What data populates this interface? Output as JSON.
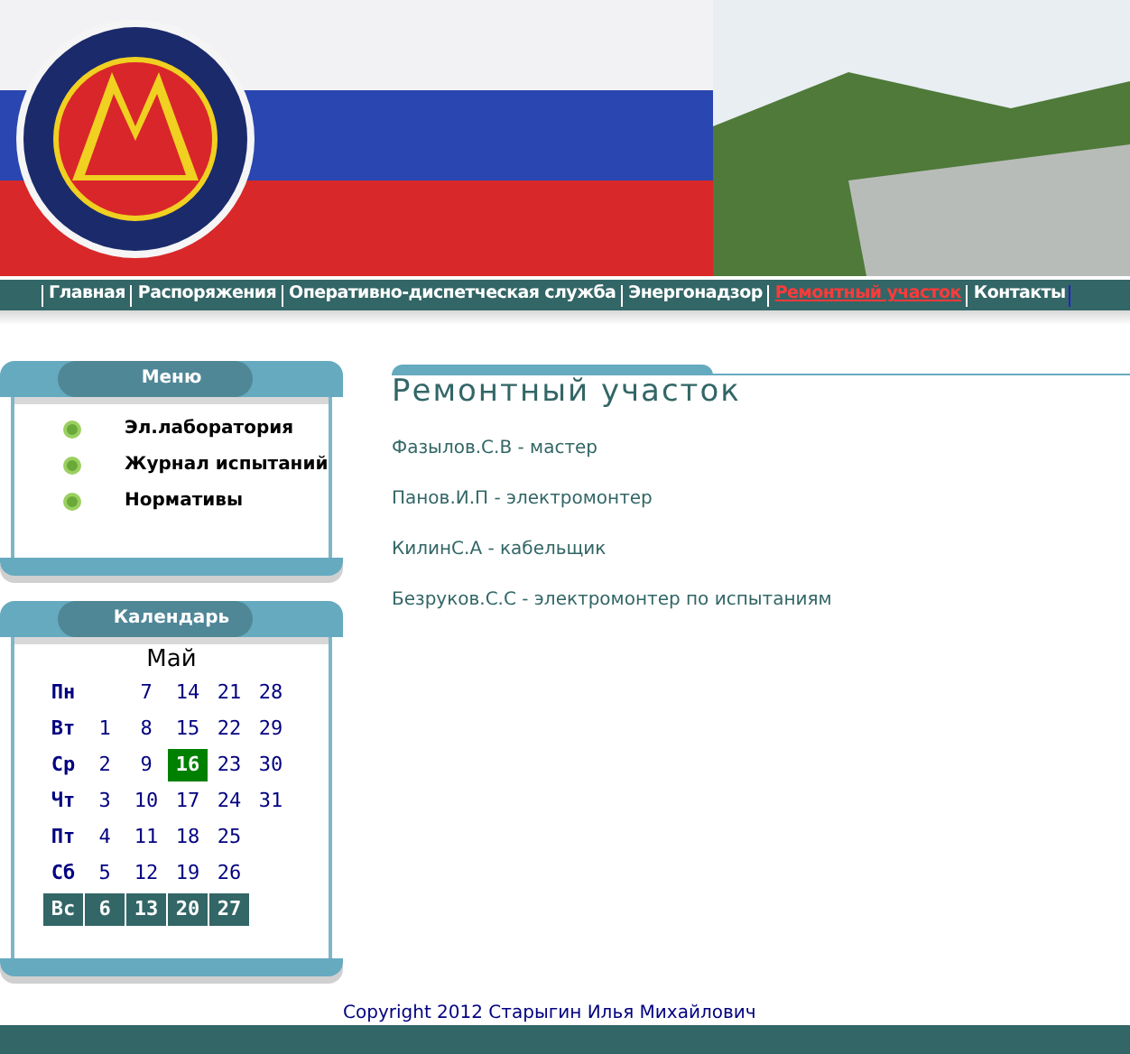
{
  "nav": [
    {
      "label": "Главная",
      "selected": false
    },
    {
      "label": "Распоряжения",
      "selected": false
    },
    {
      "label": "Оперативно-диспетческая служба",
      "selected": false
    },
    {
      "label": "Энергонадзор",
      "selected": false
    },
    {
      "label": "Ремонтный участок",
      "selected": true
    },
    {
      "label": "Контакты",
      "selected": false
    }
  ],
  "menu": {
    "title": "Меню",
    "items": [
      "Эл.лаборатория",
      "Журнал испытаний",
      "Нормативы"
    ]
  },
  "calendar": {
    "title": "Календарь",
    "month": "Май",
    "rows": [
      {
        "day": "Пн",
        "weekend": false,
        "cells": [
          null,
          {
            "text": "7",
            "selected": false
          },
          {
            "text": "14",
            "selected": false
          },
          {
            "text": "21",
            "selected": false
          },
          {
            "text": "28",
            "selected": false
          }
        ]
      },
      {
        "day": "Вт",
        "weekend": false,
        "cells": [
          {
            "text": "1",
            "selected": false
          },
          {
            "text": "8",
            "selected": false
          },
          {
            "text": "15",
            "selected": false
          },
          {
            "text": "22",
            "selected": false
          },
          {
            "text": "29",
            "selected": false
          }
        ]
      },
      {
        "day": "Ср",
        "weekend": false,
        "cells": [
          {
            "text": "2",
            "selected": false
          },
          {
            "text": "9",
            "selected": false
          },
          {
            "text": "16",
            "selected": true
          },
          {
            "text": "23",
            "selected": false
          },
          {
            "text": "30",
            "selected": false
          }
        ]
      },
      {
        "day": "Чт",
        "weekend": false,
        "cells": [
          {
            "text": "3",
            "selected": false
          },
          {
            "text": "10",
            "selected": false
          },
          {
            "text": "17",
            "selected": false
          },
          {
            "text": "24",
            "selected": false
          },
          {
            "text": "31",
            "selected": false
          }
        ]
      },
      {
        "day": "Пт",
        "weekend": false,
        "cells": [
          {
            "text": "4",
            "selected": false
          },
          {
            "text": "11",
            "selected": false
          },
          {
            "text": "18",
            "selected": false
          },
          {
            "text": "25",
            "selected": false
          }
        ]
      },
      {
        "day": "Сб",
        "weekend": false,
        "cells": [
          {
            "text": "5",
            "selected": false
          },
          {
            "text": "12",
            "selected": false
          },
          {
            "text": "19",
            "selected": false
          },
          {
            "text": "26",
            "selected": false
          }
        ]
      },
      {
        "day": "Вс",
        "weekend": true,
        "cells": [
          {
            "text": "6",
            "selected": false
          },
          {
            "text": "13",
            "selected": false
          },
          {
            "text": "20",
            "selected": false
          },
          {
            "text": "27",
            "selected": false
          }
        ]
      }
    ]
  },
  "content": {
    "title": "Ремонтный участок",
    "staff": [
      "Фазылов.С.В - мастер",
      "Панов.И.П - электромонтер",
      "КилинС.А - кабельщик",
      "Безруков.С.С - электромонтер по испытаниям"
    ]
  },
  "footer": "Copyright 2012 Старыгин Илья Михайлович"
}
